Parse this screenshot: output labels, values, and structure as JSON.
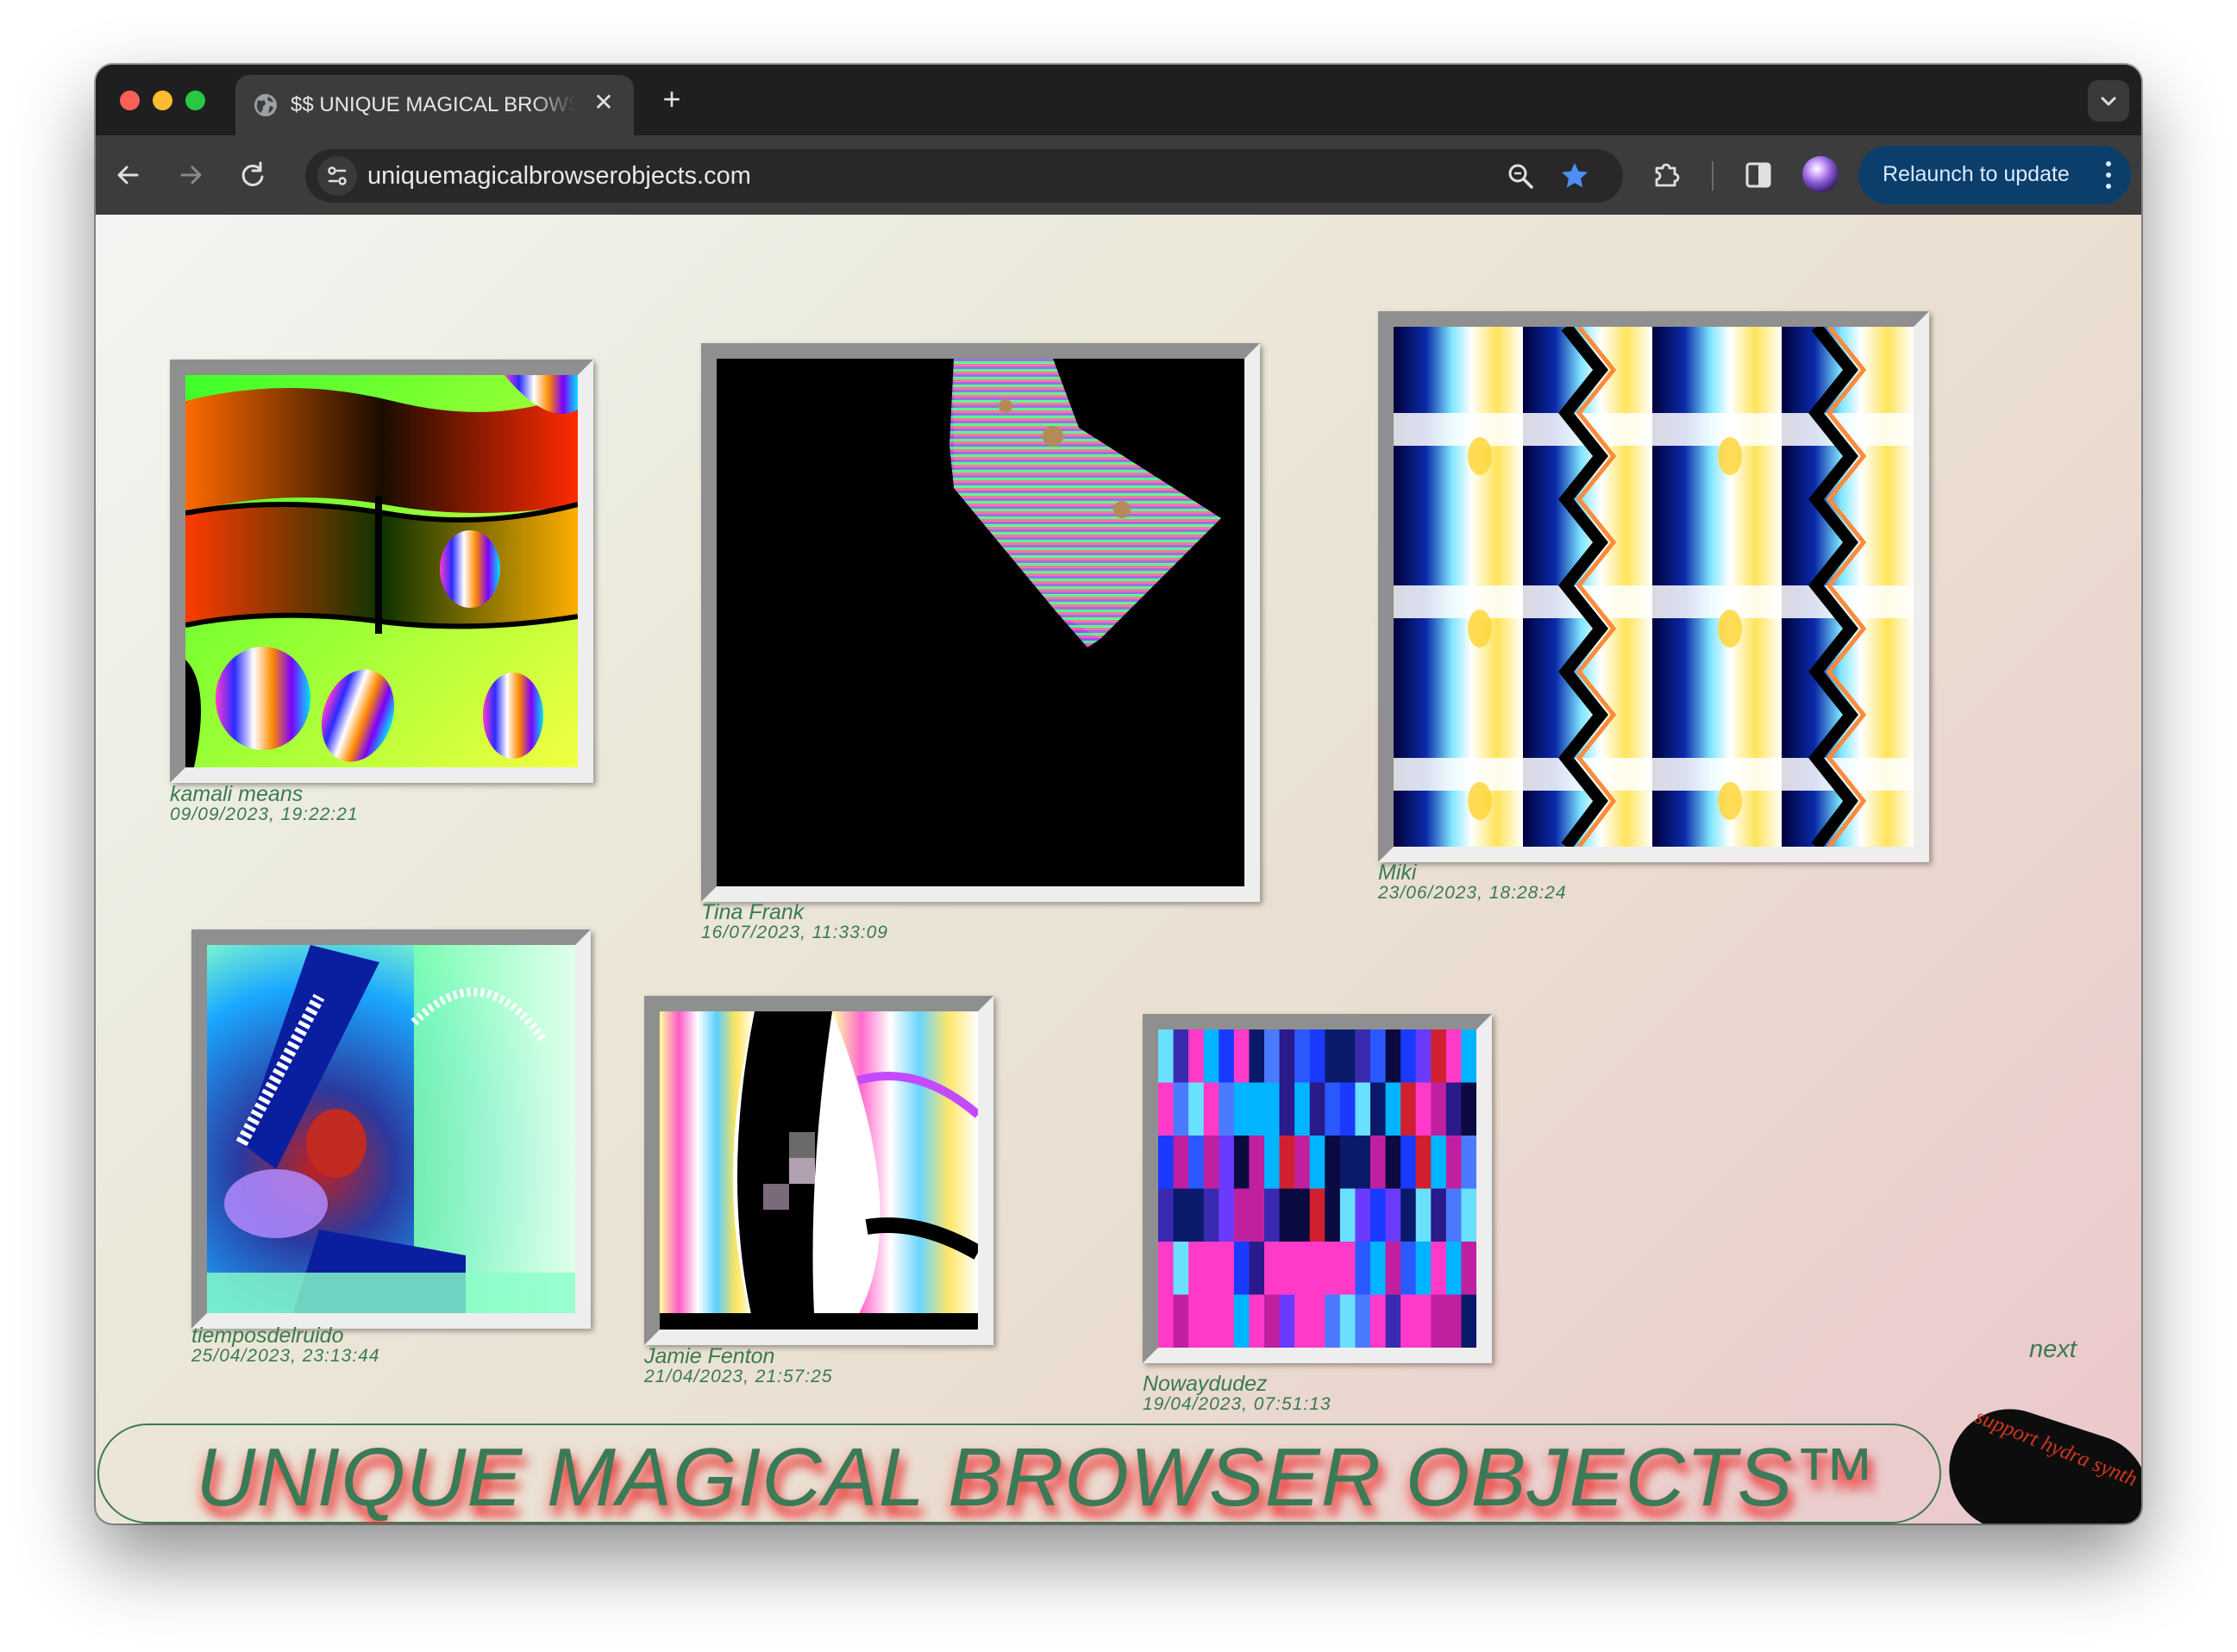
{
  "browser": {
    "tab_title": "$$ UNIQUE MAGICAL BROWSER OBJECTS",
    "tab_close": "✕",
    "new_tab": "+",
    "url": "uniquemagicalbrowserobjects.com",
    "relaunch_label": "Relaunch to update",
    "bookmark_color": "#4d8ef7",
    "relaunch_color": "#0b3e6b"
  },
  "gallery": [
    {
      "author": "kamali means",
      "date": "09/09/2023, 19:22:21"
    },
    {
      "author": "Tina Frank",
      "date": "16/07/2023, 11:33:09"
    },
    {
      "author": "Miki",
      "date": "23/06/2023, 18:28:24"
    },
    {
      "author": "tiemposdelruido",
      "date": "25/04/2023, 23:13:44"
    },
    {
      "author": "Jamie Fenton",
      "date": "21/04/2023, 21:57:25"
    },
    {
      "author": "Nowaydudez",
      "date": "19/04/2023, 07:51:13"
    }
  ],
  "nav": {
    "next": "next"
  },
  "banner": {
    "title": "UNIQUE MAGICAL BROWSER OBJECTS™"
  },
  "support": {
    "label": "support hydra synth"
  },
  "colors": {
    "caption": "#3a7a4f",
    "banner_shadow": "#e62828",
    "support_text": "#d2361a"
  }
}
